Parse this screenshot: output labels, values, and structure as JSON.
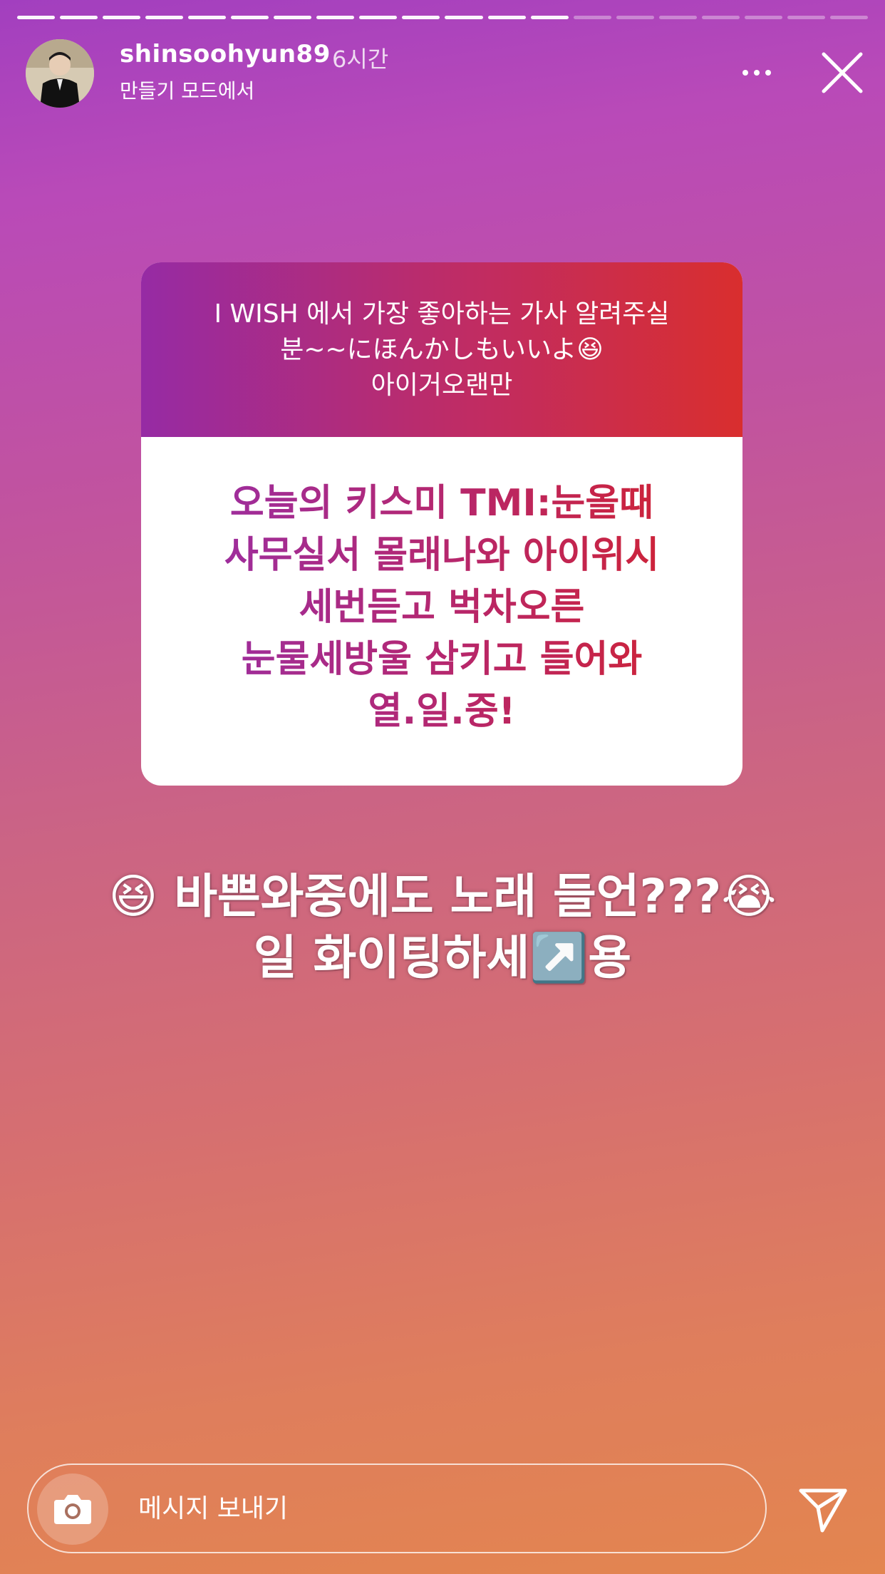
{
  "story": {
    "progress_total": 20,
    "progress_done": 13
  },
  "header": {
    "username": "shinsoohyun89",
    "time": "6시간",
    "mode": "만들기 모드에서"
  },
  "question_card": {
    "question": "I WISH 에서 가장 좋아하는 가사 알려주실\n분~~にほんかしもいいよ😆\n아이거오랜만",
    "answer": "오늘의 키스미 TMI:눈올때\n사무실서 몰래나와 아이위시\n세번듣고 벅차오른\n눈물세방울 삼키고 들어와\n열.일.중!"
  },
  "caption": {
    "text": "😆 바쁜와중에도 노래 들언???😭\n일 화이팅하세↗️용"
  },
  "footer": {
    "message_placeholder": "메시지 보내기"
  },
  "icons": {
    "more": "more-icon",
    "close": "close-icon",
    "camera": "camera-icon",
    "send": "send-icon"
  }
}
